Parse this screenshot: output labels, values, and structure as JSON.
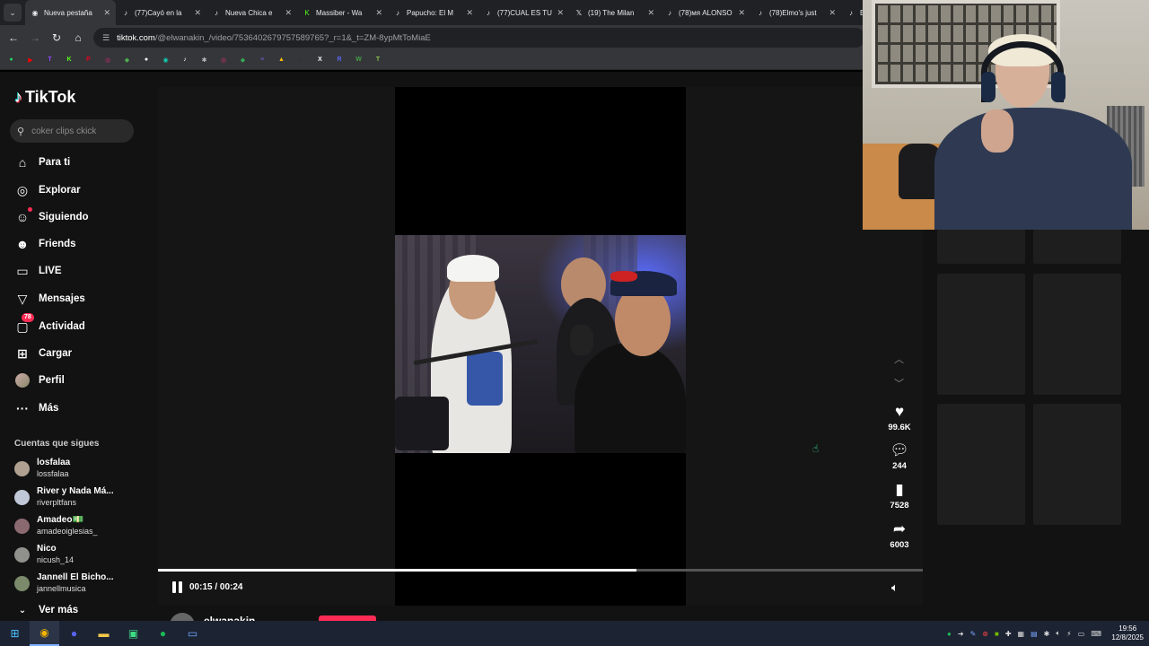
{
  "browser": {
    "tabs": [
      {
        "title": "Nueva pestaña",
        "favicon": "chrome-icon",
        "active": true
      },
      {
        "title": "(77)Cayó en la",
        "favicon": "tiktok-icon"
      },
      {
        "title": "Nueva Chica e",
        "favicon": "tiktok-icon"
      },
      {
        "title": "Massiber - Wa",
        "favicon": "kick-icon"
      },
      {
        "title": "Papucho: El M",
        "favicon": "tiktok-icon"
      },
      {
        "title": "(77)CUAL ES TU",
        "favicon": "tiktok-icon"
      },
      {
        "title": "(19) The Milan",
        "favicon": "x-icon"
      },
      {
        "title": "(78)мя ALONSO",
        "favicon": "tiktok-icon"
      },
      {
        "title": "(78)Elmo's just",
        "favicon": "tiktok-icon"
      },
      {
        "title": "Bu",
        "favicon": "tiktok-icon"
      }
    ],
    "url_host": "tiktok.com",
    "url_path": "/@elwanakin_/video/7536402679757589765?_r=1&_t=ZM-8ypMtToMiaE",
    "bookmarks": [
      {
        "icon": "whatsapp-icon",
        "glyph": "●",
        "color": "#25d366"
      },
      {
        "icon": "youtube-icon",
        "glyph": "▶",
        "color": "#ff0000"
      },
      {
        "icon": "twitch-icon",
        "glyph": "T",
        "color": "#9146ff"
      },
      {
        "icon": "kick-icon",
        "glyph": "K",
        "color": "#53fc18"
      },
      {
        "icon": "pinterest-icon",
        "glyph": "P",
        "color": "#e60023"
      },
      {
        "icon": "instagram-icon",
        "glyph": "◎",
        "color": "#d62976"
      },
      {
        "icon": "controller-icon",
        "glyph": "◆",
        "color": "#4caf50"
      },
      {
        "icon": "github-icon",
        "glyph": "●",
        "color": "#ffffff"
      },
      {
        "icon": "circle-icon",
        "glyph": "◉",
        "color": "#10d0b0"
      },
      {
        "icon": "tiktok-icon",
        "glyph": "♪",
        "color": "#ffffff"
      },
      {
        "icon": "web-icon",
        "glyph": "✱",
        "color": "#bbbbbb"
      },
      {
        "icon": "instagram-icon",
        "glyph": "◎",
        "color": "#e1306c"
      },
      {
        "icon": "maps-icon",
        "glyph": "◆",
        "color": "#34a853"
      },
      {
        "icon": "list-icon",
        "glyph": "≡",
        "color": "#6a5acd"
      },
      {
        "icon": "drive-icon",
        "glyph": "▲",
        "color": "#fbbc04"
      },
      {
        "icon": "adobe-icon",
        "glyph": "A",
        "color": "#333333"
      },
      {
        "icon": "x-icon",
        "glyph": "X",
        "color": "#ffffff"
      },
      {
        "icon": "r-icon",
        "glyph": "R",
        "color": "#5865f2"
      },
      {
        "icon": "w-icon",
        "glyph": "W",
        "color": "#43a047"
      },
      {
        "icon": "t-icon",
        "glyph": "T",
        "color": "#8bc34a"
      }
    ]
  },
  "tiktok": {
    "logo": "TikTok",
    "search_placeholder": "coker clips ckick",
    "nav": [
      {
        "label": "Para ti",
        "icon": "home-icon",
        "glyph": "⌂"
      },
      {
        "label": "Explorar",
        "icon": "compass-icon",
        "glyph": "◎"
      },
      {
        "label": "Siguiendo",
        "icon": "following-icon",
        "glyph": "☺"
      },
      {
        "label": "Friends",
        "icon": "friends-icon",
        "glyph": "☻"
      },
      {
        "label": "LIVE",
        "icon": "live-icon",
        "glyph": "▭"
      },
      {
        "label": "Mensajes",
        "icon": "messages-icon",
        "glyph": "▽"
      },
      {
        "label": "Actividad",
        "icon": "activity-icon",
        "glyph": "▢",
        "badge": "78"
      },
      {
        "label": "Cargar",
        "icon": "upload-icon",
        "glyph": "⊞"
      },
      {
        "label": "Perfil",
        "icon": "profile-avatar",
        "glyph": ""
      },
      {
        "label": "Más",
        "icon": "more-icon",
        "glyph": "···"
      }
    ],
    "following_title": "Cuentas que sigues",
    "following": [
      {
        "name": "losfalaa",
        "handle": "lossfalaa",
        "color": "#b0a090"
      },
      {
        "name": "River y Nada Má...",
        "handle": "riverpltfans",
        "color": "#c0c8d8"
      },
      {
        "name": "Amadeo💵",
        "handle": "amadeoiglesias_",
        "color": "#8a6a70"
      },
      {
        "name": "Nico",
        "handle": "nicush_14",
        "color": "#90908c"
      },
      {
        "name": "Jannell El Bicho...",
        "handle": "jannellmusica",
        "color": "#7a8a6a"
      }
    ],
    "see_more": "Ver más",
    "player": {
      "time": "00:15 / 00:24",
      "progress": 0.625
    },
    "actions": {
      "likes": "99.6K",
      "comments": "244",
      "saves": "7528",
      "shares": "6003"
    },
    "author": "elwanakin"
  },
  "taskbar": {
    "apps": [
      "windows-icon",
      "chrome-icon",
      "discord-icon",
      "folder-icon",
      "android-icon",
      "spotify-icon",
      "desktop-icon"
    ],
    "time": "19:56",
    "date": "12/8/2025"
  }
}
